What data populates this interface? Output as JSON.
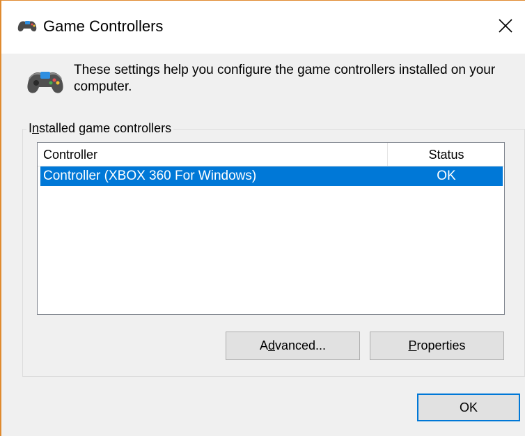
{
  "window": {
    "title": "Game Controllers",
    "accent_color": "#e08a2e",
    "title_icon": "gamepad-icon",
    "close_icon": "close-icon"
  },
  "intro": {
    "icon": "gamepad-icon",
    "text": "These settings help you configure the game controllers installed on your computer."
  },
  "group": {
    "legend_prefix": "I",
    "legend_mnemonic": "n",
    "legend_suffix": "stalled game controllers"
  },
  "list": {
    "columns": [
      "Controller",
      "Status"
    ],
    "rows": [
      {
        "controller": "Controller (XBOX 360 For Windows)",
        "status": "OK",
        "selected": true
      }
    ],
    "selection_color": "#0078d7"
  },
  "buttons": {
    "advanced": {
      "prefix": "A",
      "mnemonic": "d",
      "suffix": "vanced..."
    },
    "properties": {
      "prefix": "",
      "mnemonic": "P",
      "suffix": "roperties"
    },
    "ok": "OK"
  }
}
